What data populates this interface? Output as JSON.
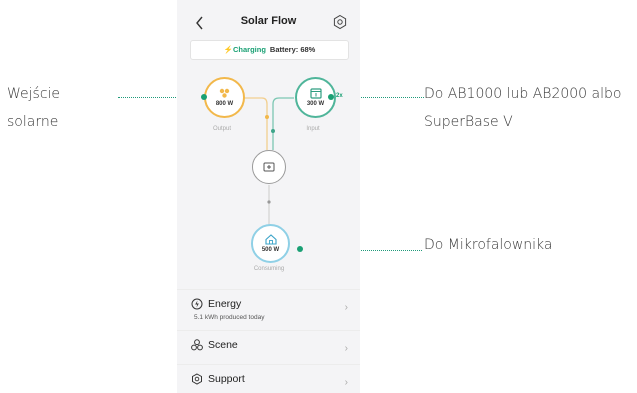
{
  "callouts": {
    "left_line1": "Wejście",
    "left_line2": "solarne",
    "right_top_line1": "Do AB1000 lub AB2000 albo",
    "right_top_line2": "SuperBase V",
    "right_bottom": "Do Mikrofalownika"
  },
  "app": {
    "title": "Solar Flow",
    "status": {
      "state": "Charging",
      "battery_label": "Battery: 68%"
    }
  },
  "flow": {
    "output": {
      "value": "800 W",
      "caption": "Output"
    },
    "input": {
      "value": "300 W",
      "caption": "Input",
      "badge": "2x"
    },
    "consuming": {
      "value": "500 W",
      "caption": "Consuming"
    }
  },
  "menu": {
    "energy": {
      "label": "Energy",
      "sub": "5.1 kWh produced today"
    },
    "scene": {
      "label": "Scene"
    },
    "support": {
      "label": "Support"
    },
    "chevron": "›"
  },
  "colors": {
    "accent": "#1aa074",
    "solar": "#f2b84b",
    "input": "#4fb59a",
    "consuming": "#8fd0e6"
  },
  "icons": [
    "back-icon",
    "settings-icon",
    "lightning-icon",
    "solar-panel-icon",
    "battery-icon",
    "hub-icon",
    "home-icon",
    "energy-icon",
    "scene-icon",
    "support-icon",
    "chevron-right-icon"
  ]
}
